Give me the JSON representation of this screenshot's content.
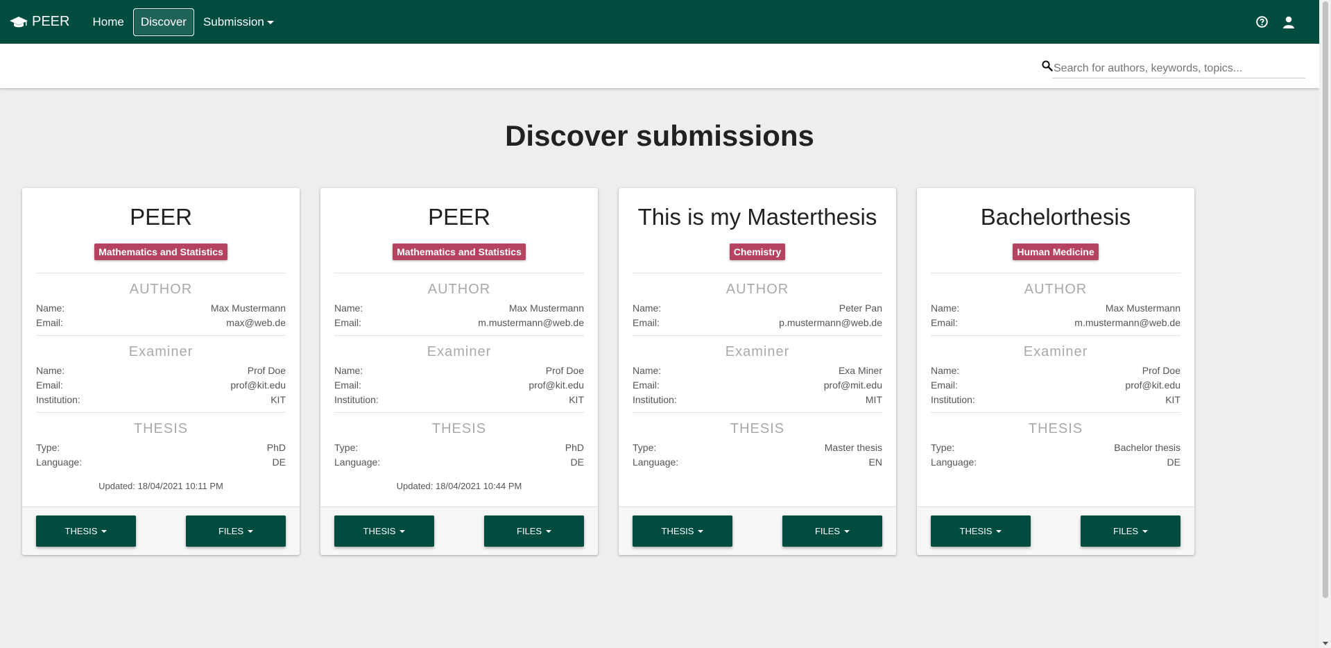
{
  "navbar": {
    "brand": "PEER",
    "items": [
      {
        "label": "Home"
      },
      {
        "label": "Discover"
      },
      {
        "label": "Submission"
      }
    ]
  },
  "search": {
    "placeholder": "Search for authors, keywords, topics..."
  },
  "page": {
    "title": "Discover submissions"
  },
  "cards": [
    {
      "title": "PEER",
      "badge": "Mathematics and Statistics",
      "author_heading": "AUTHOR",
      "author": {
        "name_label": "Name:",
        "name": "Max Mustermann",
        "email_label": "Email:",
        "email": "max@web.de"
      },
      "examiner_heading": "Examiner",
      "examiner": {
        "name_label": "Name:",
        "name": "Prof Doe",
        "email_label": "Email:",
        "email": "prof@kit.edu",
        "institution_label": "Institution:",
        "institution": "KIT"
      },
      "thesis_heading": "THESIS",
      "thesis": {
        "type_label": "Type:",
        "type": "PhD",
        "language_label": "Language:",
        "language": "DE"
      },
      "updated": "Updated: 18/04/2021 10:11 PM",
      "thesis_button": "THESIS",
      "files_button": "FILES"
    },
    {
      "title": "PEER",
      "badge": "Mathematics and Statistics",
      "author_heading": "AUTHOR",
      "author": {
        "name_label": "Name:",
        "name": "Max Mustermann",
        "email_label": "Email:",
        "email": "m.mustermann@web.de"
      },
      "examiner_heading": "Examiner",
      "examiner": {
        "name_label": "Name:",
        "name": "Prof Doe",
        "email_label": "Email:",
        "email": "prof@kit.edu",
        "institution_label": "Institution:",
        "institution": "KIT"
      },
      "thesis_heading": "THESIS",
      "thesis": {
        "type_label": "Type:",
        "type": "PhD",
        "language_label": "Language:",
        "language": "DE"
      },
      "updated": "Updated: 18/04/2021 10:44 PM",
      "thesis_button": "THESIS",
      "files_button": "FILES"
    },
    {
      "title": "This is my Masterthesis",
      "badge": "Chemistry",
      "author_heading": "AUTHOR",
      "author": {
        "name_label": "Name:",
        "name": "Peter Pan",
        "email_label": "Email:",
        "email": "p.mustermann@web.de"
      },
      "examiner_heading": "Examiner",
      "examiner": {
        "name_label": "Name:",
        "name": "Exa Miner",
        "email_label": "Email:",
        "email": "prof@mit.edu",
        "institution_label": "Institution:",
        "institution": "MIT"
      },
      "thesis_heading": "THESIS",
      "thesis": {
        "type_label": "Type:",
        "type": "Master thesis",
        "language_label": "Language:",
        "language": "EN"
      },
      "updated": "",
      "thesis_button": "THESIS",
      "files_button": "FILES"
    },
    {
      "title": "Bachelorthesis",
      "badge": "Human Medicine",
      "author_heading": "AUTHOR",
      "author": {
        "name_label": "Name:",
        "name": "Max Mustermann",
        "email_label": "Email:",
        "email": "m.mustermann@web.de"
      },
      "examiner_heading": "Examiner",
      "examiner": {
        "name_label": "Name:",
        "name": "Prof Doe",
        "email_label": "Email:",
        "email": "prof@kit.edu",
        "institution_label": "Institution:",
        "institution": "KIT"
      },
      "thesis_heading": "THESIS",
      "thesis": {
        "type_label": "Type:",
        "type": "Bachelor thesis",
        "language_label": "Language:",
        "language": "DE"
      },
      "updated": "",
      "thesis_button": "THESIS",
      "files_button": "FILES"
    }
  ],
  "icons": {
    "brand": "graduation-cap-icon",
    "help": "help-circle-icon",
    "account": "user-icon",
    "search": "search-icon"
  },
  "colors": {
    "primary": "#004d40",
    "badge": "#b5425f",
    "background": "#eeeeee"
  }
}
